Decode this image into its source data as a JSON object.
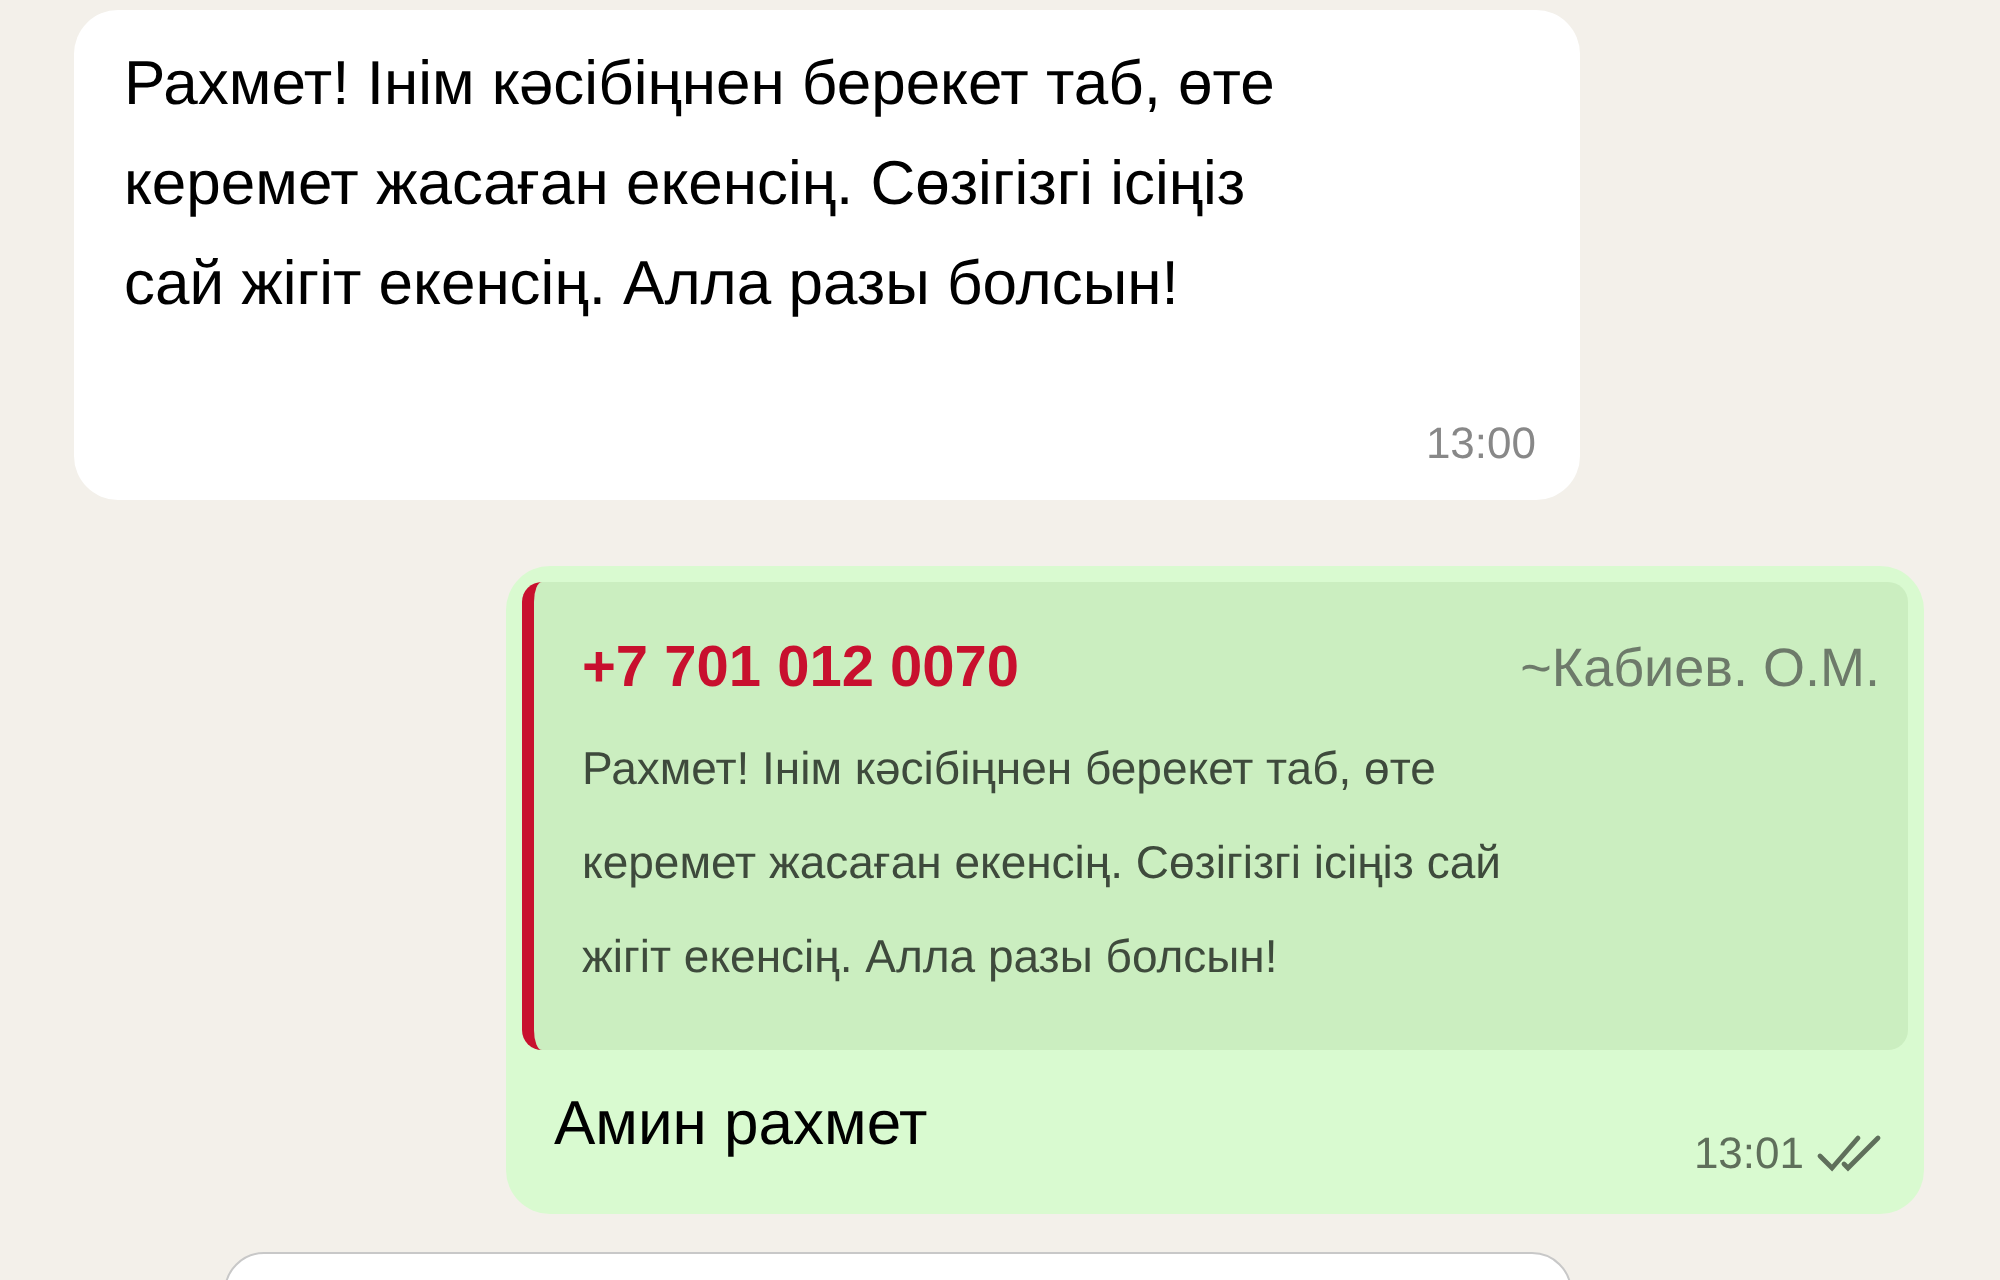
{
  "messages": [
    {
      "kind": "incoming",
      "text": "Рахмет! Інім кәсібіңнен берекет таб, өте керемет жасаған екенсің. Сөзігізгі ісіңіз сай жігіт екенсің. Алла разы болсын!",
      "time": "13:00"
    },
    {
      "kind": "outgoing",
      "quote": {
        "phone": "+7 701 012 0070",
        "sender": "~Кабиев. О.М.",
        "text": "Рахмет! Інім кәсібіңнен берекет таб, өте керемет жасаған екенсің. Сөзігізгі ісіңіз сай жігіт екенсің. Алла разы болсын!"
      },
      "text": "Амин рахмет",
      "time": "13:01",
      "read": true
    }
  ]
}
